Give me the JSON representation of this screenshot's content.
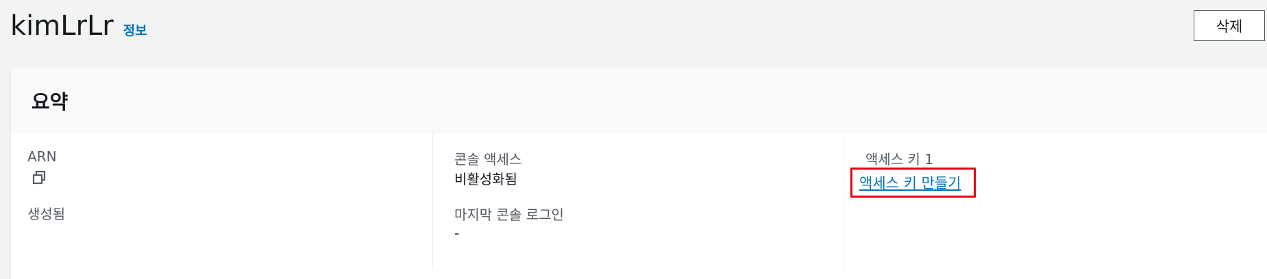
{
  "header": {
    "title": "kimLrLr",
    "info_label": "정보",
    "delete_label": "삭제"
  },
  "summary": {
    "title": "요약",
    "arn_label": "ARN",
    "created_label": "생성됨",
    "console_access_label": "콘솔 액세스",
    "console_access_value": "비활성화됨",
    "last_console_login_label": "마지막 콘솔 로그인",
    "last_console_login_value": "-",
    "access_key_label": "액세스 키 1",
    "create_access_key_label": "액세스 키 만들기"
  },
  "icons": {
    "copy": "copy-icon"
  },
  "colors": {
    "link": "#0073bb",
    "highlight_border": "#e0000f",
    "background": "#f2f3f3"
  }
}
